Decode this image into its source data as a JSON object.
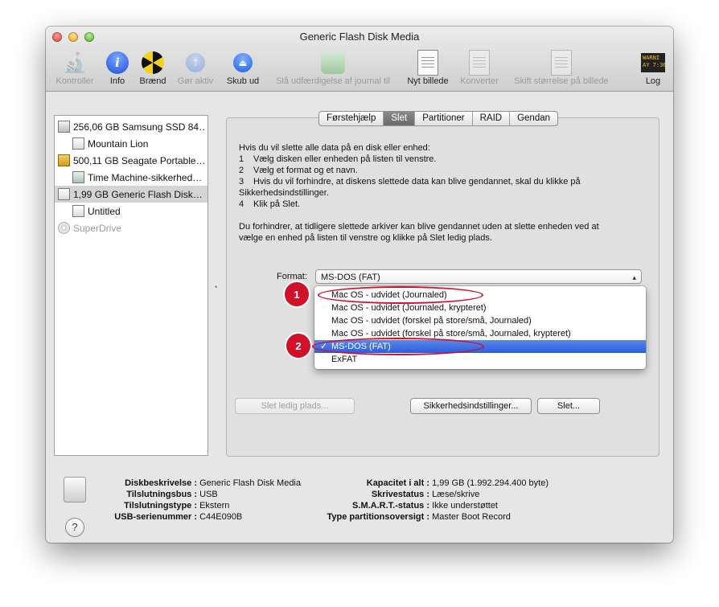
{
  "window": {
    "title": "Generic Flash Disk Media"
  },
  "toolbar": {
    "verify": "Kontroller",
    "info": "Info",
    "burn": "Brænd",
    "mount": "Gør aktiv",
    "eject": "Skub ud",
    "journal": "Slå udfærdigelse af journal til",
    "new_image": "Nyt billede",
    "convert": "Konverter",
    "resize": "Skift størrelse på billede",
    "log": "Log",
    "log_display": "WARNI\nAY 7:36"
  },
  "sidebar": {
    "items": [
      {
        "label": "256,06 GB Samsung SSD 84…",
        "icon": "internal-disk-icon"
      },
      {
        "label": "Mountain Lion",
        "icon": "volume-icon"
      },
      {
        "label": "500,11 GB Seagate Portable…",
        "icon": "usb-disk-icon"
      },
      {
        "label": "Time Machine-sikkerhed…",
        "icon": "time-machine-icon"
      },
      {
        "label": "1,99 GB Generic Flash Disk…",
        "icon": "flash-disk-icon"
      },
      {
        "label": "Untitled",
        "icon": "volume-icon"
      },
      {
        "label": "SuperDrive",
        "icon": "superdrive-icon"
      }
    ]
  },
  "tabs": [
    "Førstehjælp",
    "Slet",
    "Partitioner",
    "RAID",
    "Gendan"
  ],
  "instructions": {
    "l1": "Hvis du vil slette alle data på en disk eller enhed:",
    "l2n": "1",
    "l2": "Vælg disken eller enheden på listen til venstre.",
    "l3n": "2",
    "l3": "Vælg et format og et navn.",
    "l4n": "3",
    "l4": "Hvis du vil forhindre, at diskens slettede data kan blive gendannet, skal du klikke på",
    "l5": "Sikkerhedsindstillinger.",
    "l6n": "4",
    "l6": "Klik på Slet.",
    "l7": "Du forhindrer, at tidligere slettede arkiver kan blive gendannet uden at slette enheden ved at",
    "l8": "vælge en enhed på listen til venstre og klikke på Slet ledig plads."
  },
  "format": {
    "label": "Format:",
    "selected": "MS-DOS (FAT)",
    "options": [
      "Mac OS - udvidet (Journaled)",
      "Mac OS - udvidet (Journaled, krypteret)",
      "Mac OS - udvidet (forskel på store/små, Journaled)",
      "Mac OS - udvidet (forskel på store/små, Journaled, krypteret)",
      "MS-DOS (FAT)",
      "ExFAT"
    ],
    "check": "✓"
  },
  "annotations": {
    "one": "1",
    "two": "2"
  },
  "buttons": {
    "erase_free": "Slet ledig plads...",
    "security": "Sikkerhedsindstillinger...",
    "erase": "Slet..."
  },
  "info": {
    "desc_k": "Diskbeskrivelse :",
    "desc_v": "Generic Flash Disk Media",
    "bus_k": "Tilslutningsbus :",
    "bus_v": "USB",
    "type_k": "Tilslutningstype :",
    "type_v": "Ekstern",
    "serial_k": "USB-serienummer :",
    "serial_v": "C44E090B",
    "cap_k": "Kapacitet i alt :",
    "cap_v": "1,99 GB (1.992.294.400 byte)",
    "write_k": "Skrivestatus :",
    "write_v": "Læse/skrive",
    "smart_k": "S.M.A.R.T.-status :",
    "smart_v": "Ikke understøttet",
    "part_k": "Type partitionsoversigt :",
    "part_v": "Master Boot Record"
  },
  "help": "?"
}
